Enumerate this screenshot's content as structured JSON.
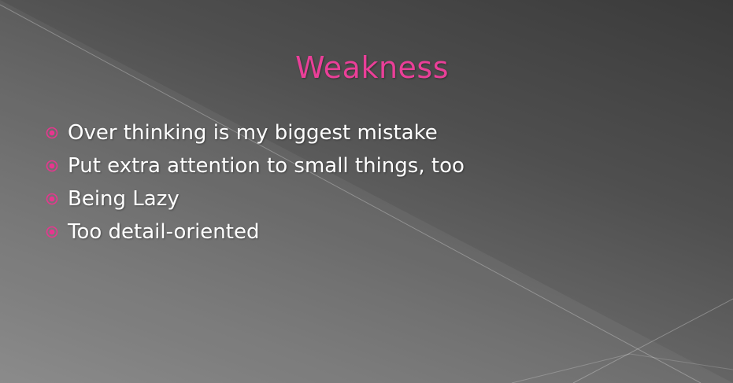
{
  "slide": {
    "title": "Weakness",
    "bullets": [
      "Over thinking is my biggest mistake",
      "Put extra attention to small things, too",
      "Being Lazy",
      "Too detail-oriented"
    ]
  },
  "colors": {
    "title": "#ea3f98",
    "bullet_icon": "#e8368f",
    "text": "#ffffff"
  },
  "icons": {
    "bullet": "circle-dot-icon"
  }
}
